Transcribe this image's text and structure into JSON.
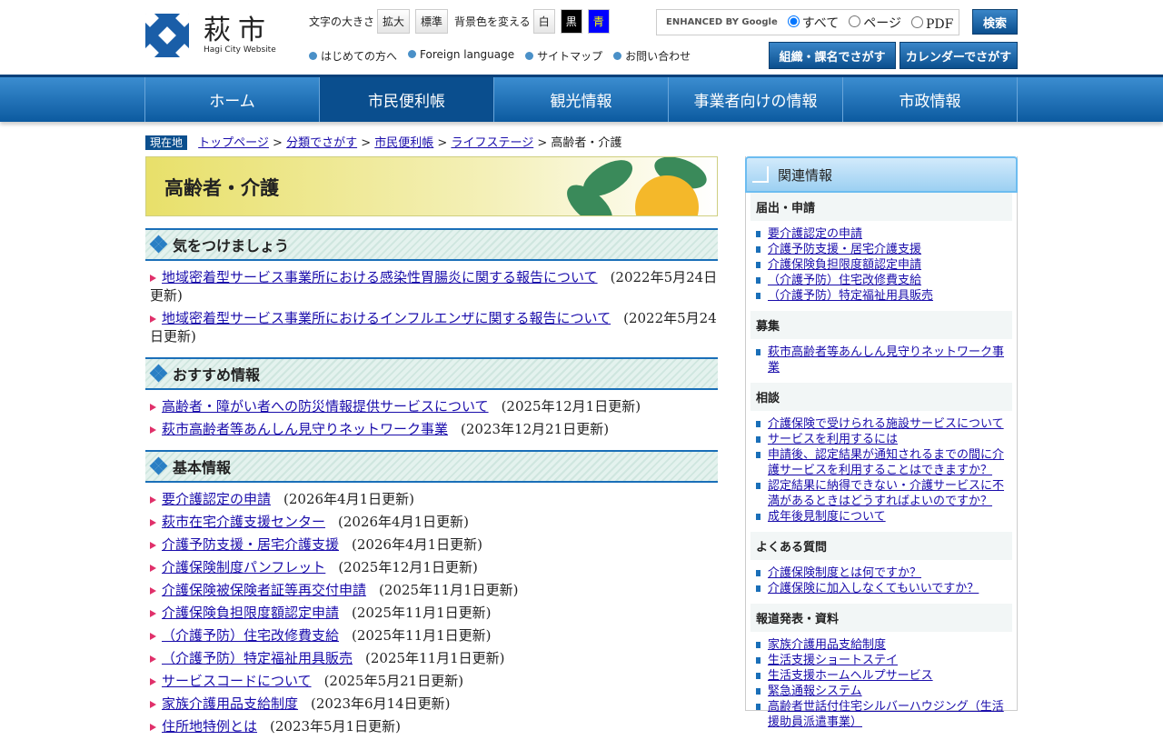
{
  "header": {
    "logo_kanji": "萩市",
    "logo_en": "Hagi City Website",
    "font_size_label": "文字の大きさ",
    "font_large": "拡大",
    "font_normal": "標準",
    "bg_label": "背景色を変える",
    "bg_white": "白",
    "bg_black": "黒",
    "bg_blue": "青",
    "search_brand": "ENHANCED BY Google",
    "search_opts": [
      "すべて",
      "ページ",
      "PDF"
    ],
    "search_button": "検索",
    "links": [
      "はじめての方へ",
      "Foreign language",
      "サイトマップ",
      "お問い合わせ"
    ],
    "org_button": "組織・課名でさがす",
    "calendar_button": "カレンダーでさがす"
  },
  "nav": [
    "ホーム",
    "市民便利帳",
    "観光情報",
    "事業者向けの情報",
    "市政情報"
  ],
  "breadcrumb": {
    "here": "現在地",
    "items": [
      "トップページ",
      "分類でさがす",
      "市民便利帳",
      "ライフステージ"
    ],
    "current": "高齢者・介護"
  },
  "page_title": "高齢者・介護",
  "sections": [
    {
      "title": "気をつけましょう",
      "items": [
        {
          "t": "地域密着型サービス事業所における感染性胃腸炎に関する報告について",
          "d": "(2022年5月24日更新)"
        },
        {
          "t": "地域密着型サービス事業所におけるインフルエンザに関する報告について",
          "d": "(2022年5月24日更新)"
        }
      ]
    },
    {
      "title": "おすすめ情報",
      "items": [
        {
          "t": "高齢者・障がい者への防災情報提供サービスについて",
          "d": "(2025年12月1日更新)"
        },
        {
          "t": "萩市高齢者等あんしん見守りネットワーク事業",
          "d": "(2023年12月21日更新)"
        }
      ]
    },
    {
      "title": "基本情報",
      "items": [
        {
          "t": "要介護認定の申請",
          "d": "(2026年4月1日更新)"
        },
        {
          "t": "萩市在宅介護支援センター",
          "d": "(2026年4月1日更新)"
        },
        {
          "t": "介護予防支援・居宅介護支援",
          "d": "(2026年4月1日更新)"
        },
        {
          "t": "介護保険制度パンフレット",
          "d": "(2025年12月1日更新)"
        },
        {
          "t": "介護保険被保険者証等再交付申請",
          "d": "(2025年11月1日更新)"
        },
        {
          "t": "介護保険負担限度額認定申請",
          "d": "(2025年11月1日更新)"
        },
        {
          "t": "（介護予防）住宅改修費支給",
          "d": "(2025年11月1日更新)"
        },
        {
          "t": "（介護予防）特定福祉用具販売",
          "d": "(2025年11月1日更新)"
        },
        {
          "t": "サービスコードについて",
          "d": "(2025年5月21日更新)"
        },
        {
          "t": "家族介護用品支給制度",
          "d": "(2023年6月14日更新)"
        },
        {
          "t": "住所地特例とは",
          "d": "(2023年5月1日更新)"
        }
      ]
    }
  ],
  "sidebar": {
    "title": "関連情報",
    "groups": [
      {
        "title": "届出・申請",
        "items": [
          "要介護認定の申請",
          "介護予防支援・居宅介護支援",
          "介護保険負担限度額認定申請",
          "（介護予防）住宅改修費支給",
          "（介護予防）特定福祉用具販売"
        ]
      },
      {
        "title": "募集",
        "items": [
          "萩市高齢者等あんしん見守りネットワーク事業"
        ]
      },
      {
        "title": "相談",
        "items": [
          "介護保険で受けられる施設サービスについて",
          "サービスを利用するには",
          "申請後、認定結果が通知されるまでの間に介護サービスを利用することはできますか？",
          "認定結果に納得できない・介護サービスに不満があるときはどうすればよいのですか？",
          "成年後見制度について"
        ]
      },
      {
        "title": "よくある質問",
        "items": [
          "介護保険制度とは何ですか？",
          "介護保険に加入しなくてもいいですか？"
        ]
      },
      {
        "title": "報道発表・資料",
        "items": [
          "家族介護用品支給制度",
          "生活支援ショートステイ",
          "生活支援ホームヘルプサービス",
          "緊急通報システム",
          "高齢者世話付住宅シルバーハウジング（生活援助員派遣事業）"
        ]
      }
    ]
  }
}
